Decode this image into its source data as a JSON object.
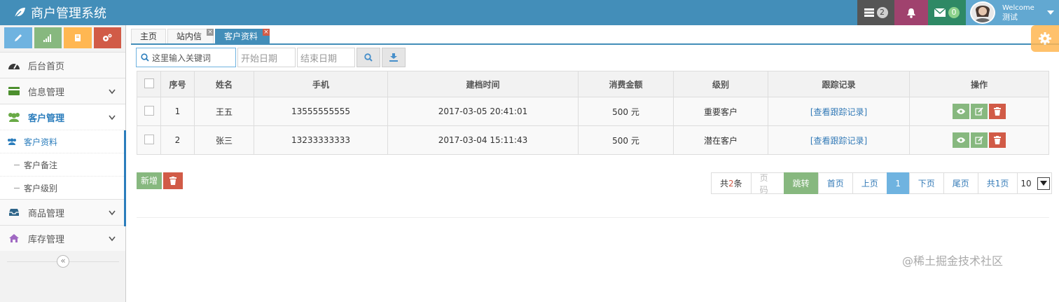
{
  "header": {
    "title": "商户管理系统",
    "badges": [
      "2",
      "0"
    ],
    "welcome": "Welcome",
    "username": "测试",
    "colors": {
      "bar": "#438eb9",
      "tasks": "#555555",
      "notify": "#a0426e",
      "mail": "#2e8965",
      "user": "#62a8d1"
    }
  },
  "sidebar": {
    "shortcut_colors": [
      "#6fb3e0",
      "#87b87f",
      "#ffb752",
      "#d15b47"
    ],
    "items": [
      {
        "label": "后台首页",
        "icon": "dashboard-icon"
      },
      {
        "label": "信息管理",
        "icon": "credit-card-icon"
      },
      {
        "label": "客户管理",
        "icon": "users-icon"
      },
      {
        "label": "商品管理",
        "icon": "inbox-icon"
      },
      {
        "label": "库存管理",
        "icon": "home-icon"
      }
    ],
    "sub_items": [
      "客户资料",
      "客户备注",
      "客户级别"
    ]
  },
  "tabs": [
    "主页",
    "站内信",
    "客户资料"
  ],
  "toolbar": {
    "search_placeholder": "这里输入关键词",
    "start_date": "开始日期",
    "end_date": "结束日期"
  },
  "table": {
    "headers": [
      "序号",
      "姓名",
      "手机",
      "建档时间",
      "消费金额",
      "级别",
      "跟踪记录",
      "操作"
    ],
    "rows": [
      {
        "no": "1",
        "name": "王五",
        "phone": "13555555555",
        "created": "2017-03-05 20:41:01",
        "amount": "500 元",
        "level": "重要客户",
        "track": "[查看跟踪记录]"
      },
      {
        "no": "2",
        "name": "张三",
        "phone": "13233333333",
        "created": "2017-03-04 15:11:43",
        "amount": "500 元",
        "level": "潜在客户",
        "track": "[查看跟踪记录]"
      }
    ]
  },
  "actions": {
    "add": "新增"
  },
  "pager": {
    "total_prefix": "共",
    "total_count": "2",
    "total_suffix": "条",
    "page_input": "页码",
    "jump": "跳转",
    "first": "首页",
    "prev": "上页",
    "current": "1",
    "next": "下页",
    "last": "尾页",
    "pages": "共1页",
    "page_size": "10"
  },
  "watermark": "@稀土掘金技术社区"
}
